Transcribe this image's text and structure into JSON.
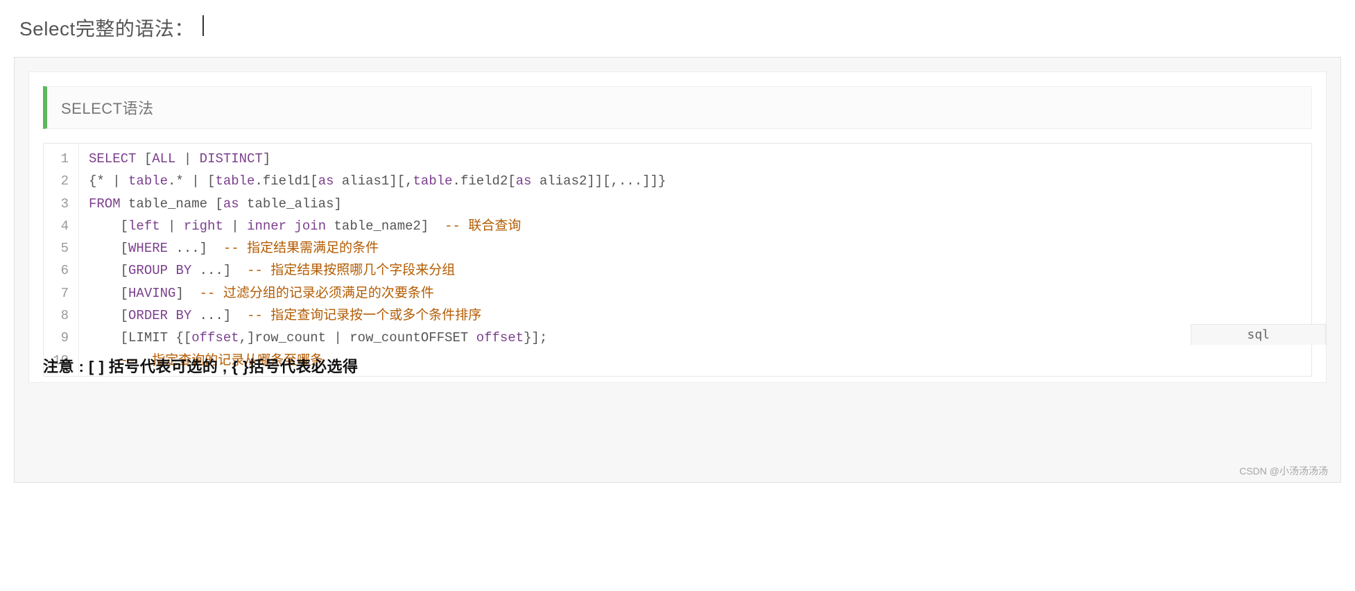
{
  "heading": "Select完整的语法：",
  "block_title": "SELECT语法",
  "code_lines": [
    [
      {
        "t": "SELECT",
        "c": "keyword"
      },
      {
        "t": " [",
        "c": "default"
      },
      {
        "t": "ALL",
        "c": "keyword"
      },
      {
        "t": " | ",
        "c": "default"
      },
      {
        "t": "DISTINCT",
        "c": "keyword"
      },
      {
        "t": "]",
        "c": "default"
      }
    ],
    [
      {
        "t": "{* | ",
        "c": "default"
      },
      {
        "t": "table",
        "c": "keyword"
      },
      {
        "t": ".* | [",
        "c": "default"
      },
      {
        "t": "table",
        "c": "keyword"
      },
      {
        "t": ".field1[",
        "c": "default"
      },
      {
        "t": "as",
        "c": "keyword"
      },
      {
        "t": " alias1][,",
        "c": "default"
      },
      {
        "t": "table",
        "c": "keyword"
      },
      {
        "t": ".field2[",
        "c": "default"
      },
      {
        "t": "as",
        "c": "keyword"
      },
      {
        "t": " alias2]][,...]]}",
        "c": "default"
      }
    ],
    [
      {
        "t": "FROM",
        "c": "keyword"
      },
      {
        "t": " table_name [",
        "c": "default"
      },
      {
        "t": "as",
        "c": "keyword"
      },
      {
        "t": " table_alias]",
        "c": "default"
      }
    ],
    [
      {
        "t": "    [",
        "c": "default"
      },
      {
        "t": "left",
        "c": "keyword"
      },
      {
        "t": " | ",
        "c": "default"
      },
      {
        "t": "right",
        "c": "keyword"
      },
      {
        "t": " | ",
        "c": "default"
      },
      {
        "t": "inner",
        "c": "keyword"
      },
      {
        "t": " ",
        "c": "default"
      },
      {
        "t": "join",
        "c": "keyword"
      },
      {
        "t": " table_name2]  ",
        "c": "default"
      },
      {
        "t": "-- 联合查询",
        "c": "comment"
      }
    ],
    [
      {
        "t": "    [",
        "c": "default"
      },
      {
        "t": "WHERE",
        "c": "keyword"
      },
      {
        "t": " ...]  ",
        "c": "default"
      },
      {
        "t": "-- 指定结果需满足的条件",
        "c": "comment"
      }
    ],
    [
      {
        "t": "    [",
        "c": "default"
      },
      {
        "t": "GROUP",
        "c": "keyword"
      },
      {
        "t": " ",
        "c": "default"
      },
      {
        "t": "BY",
        "c": "keyword"
      },
      {
        "t": " ...]  ",
        "c": "default"
      },
      {
        "t": "-- 指定结果按照哪几个字段来分组",
        "c": "comment"
      }
    ],
    [
      {
        "t": "    [",
        "c": "default"
      },
      {
        "t": "HAVING",
        "c": "keyword"
      },
      {
        "t": "]  ",
        "c": "default"
      },
      {
        "t": "-- 过滤分组的记录必须满足的次要条件",
        "c": "comment"
      }
    ],
    [
      {
        "t": "    [",
        "c": "default"
      },
      {
        "t": "ORDER",
        "c": "keyword"
      },
      {
        "t": " ",
        "c": "default"
      },
      {
        "t": "BY",
        "c": "keyword"
      },
      {
        "t": " ...]  ",
        "c": "default"
      },
      {
        "t": "-- 指定查询记录按一个或多个条件排序",
        "c": "comment"
      }
    ],
    [
      {
        "t": "    [LIMIT {[",
        "c": "default"
      },
      {
        "t": "offset",
        "c": "keyword"
      },
      {
        "t": ",]row_count | row_countOFFSET ",
        "c": "default"
      },
      {
        "t": "offset",
        "c": "keyword"
      },
      {
        "t": "}];",
        "c": "default"
      }
    ],
    [
      {
        "t": "    ",
        "c": "default"
      },
      {
        "t": "--  指定查询的记录从哪条至哪条",
        "c": "comment"
      }
    ]
  ],
  "language_badge": "sql",
  "note_footer": "注意 : [ ] 括号代表可选的 , { }括号代表必选得",
  "watermark": "CSDN @小汤汤汤汤"
}
